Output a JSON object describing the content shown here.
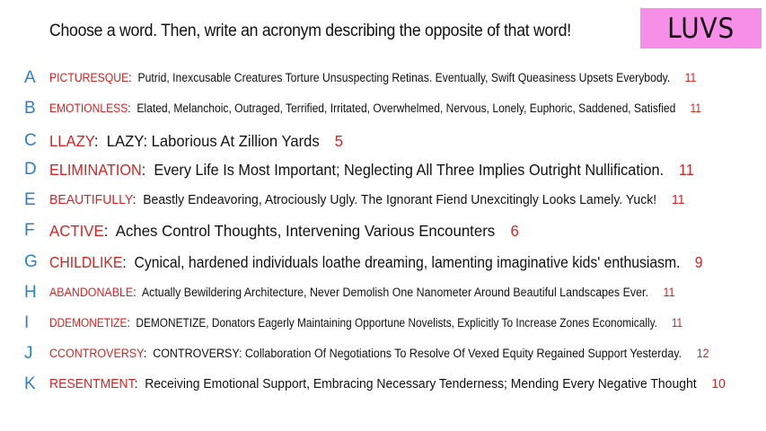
{
  "header": {
    "prompt": "Choose a word. Then, write an acronym describing the opposite of that word!",
    "badge": "LUVS"
  },
  "colors": {
    "badge_bg": "#f78fe9",
    "letter": "#2a7fd0",
    "word": "#d42424",
    "text": "#111111"
  },
  "rows": [
    {
      "letter": "A",
      "word": "PICTURESQUE",
      "acronym": "Putrid, Inexcusable Creatures Torture Unsuspecting Retinas. Eventually, Swift Queasiness Upsets Everybody.",
      "count": "11"
    },
    {
      "letter": "B",
      "word": "EMOTIONLESS",
      "acronym": "Elated, Melanchoic, Outraged, Terrified, Irritated, Overwhelmed, Nervous, Lonely, Euphoric, Saddened, Satisfied",
      "count": "11"
    },
    {
      "letter": "C",
      "word": "LLAZY",
      "acronym": "LAZY: Laborious At Zillion Yards",
      "count": "5"
    },
    {
      "letter": "D",
      "word": "ELIMINATION",
      "acronym": "Every Life Is Most Important; Neglecting All Three Implies Outright Nullification.",
      "count": "11"
    },
    {
      "letter": "E",
      "word": "BEAUTIFULLY",
      "acronym": "Beastly Endeavoring, Atrociously Ugly. The Ignorant Fiend Unexcitingly Looks Lamely. Yuck!",
      "count": "11"
    },
    {
      "letter": "F",
      "word": "ACTIVE",
      "acronym": "Aches Control Thoughts, Intervening Various Encounters",
      "count": "6"
    },
    {
      "letter": "G",
      "word": "CHILDLIKE",
      "acronym": "Cynical, hardened individuals loathe dreaming, lamenting imaginative kids' enthusiasm.",
      "count": "9"
    },
    {
      "letter": "H",
      "word": "ABANDONABLE",
      "acronym": "Actually Bewildering Architecture, Never Demolish One Nanometer Around Beautiful Landscapes Ever.",
      "count": "11"
    },
    {
      "letter": "I",
      "word": "DDEMONETIZE",
      "acronym": "DEMONETIZE, Donators Eagerly Maintaining Opportune Novelists, Explicitly To Increase Zones Economically.",
      "count": "11"
    },
    {
      "letter": "J",
      "word": "CCONTROVERSY",
      "acronym": "CONTROVERSY: Collaboration Of Negotiations To Resolve Of Vexed Equity Regained Support Yesterday.",
      "count": "12"
    },
    {
      "letter": "K",
      "word": "RESENTMENT",
      "acronym": "Receiving Emotional Support, Embracing Necessary Tenderness; Mending Every Negative Thought",
      "count": "10"
    }
  ]
}
